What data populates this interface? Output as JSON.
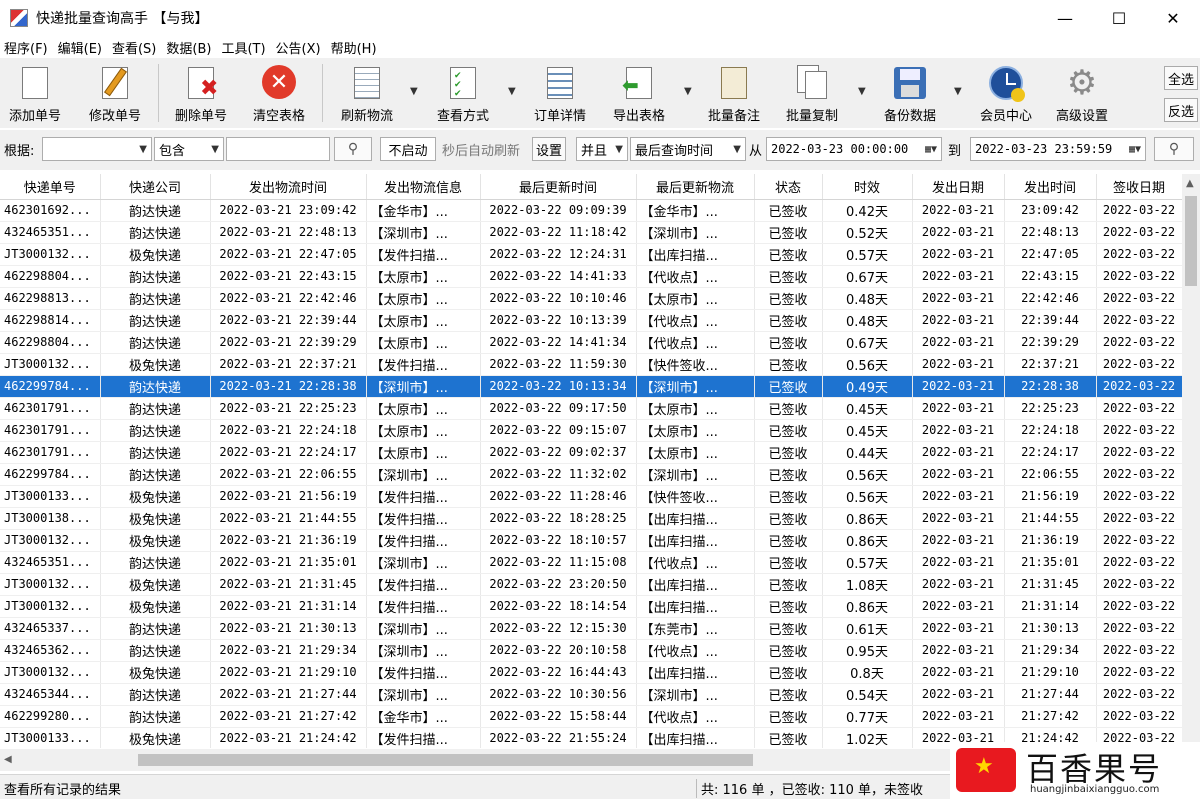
{
  "window": {
    "title": "快递批量查询高手 【与我】",
    "min_symbol": "—",
    "max_symbol": "☐",
    "close_symbol": "✕"
  },
  "menu": [
    "程序(F)",
    "编辑(E)",
    "查看(S)",
    "数据(B)",
    "工具(T)",
    "公告(X)",
    "帮助(H)"
  ],
  "toolbar": {
    "add": "添加单号",
    "edit": "修改单号",
    "delete": "删除单号",
    "clear": "清空表格",
    "refresh": "刷新物流",
    "view": "查看方式",
    "order_detail": "订单详情",
    "export": "导出表格",
    "batch_note": "批量备注",
    "batch_copy": "批量复制",
    "backup": "备份数据",
    "member": "会员中心",
    "advanced": "高级设置",
    "select_all": "全选",
    "invert": "反选"
  },
  "filter": {
    "basis_label": "根据:",
    "basis_value": "",
    "match_value": "包含",
    "keyword_value": "",
    "auto_button": "不启动",
    "auto_hint": "秒后自动刷新",
    "settings_button": "设置",
    "logic_value": "并且",
    "time_field_value": "最后查询时间",
    "from_label": "从",
    "from_value": "2022-03-23 00:00:00",
    "to_label": "到",
    "to_value": "2022-03-23 23:59:59"
  },
  "table": {
    "columns": [
      "快递单号",
      "快递公司",
      "发出物流时间",
      "发出物流信息",
      "最后更新时间",
      "最后更新物流",
      "状态",
      "时效",
      "发出日期",
      "发出时间",
      "签收日期"
    ],
    "rows": [
      [
        "462301692...",
        "韵达快递",
        "2022-03-21 23:09:42",
        "【金华市】...",
        "2022-03-22 09:09:39",
        "【金华市】...",
        "已签收",
        "0.42天",
        "2022-03-21",
        "23:09:42",
        "2022-03-22"
      ],
      [
        "432465351...",
        "韵达快递",
        "2022-03-21 22:48:13",
        "【深圳市】...",
        "2022-03-22 11:18:42",
        "【深圳市】...",
        "已签收",
        "0.52天",
        "2022-03-21",
        "22:48:13",
        "2022-03-22"
      ],
      [
        "JT3000132...",
        "极兔快递",
        "2022-03-21 22:47:05",
        "【发件扫描...",
        "2022-03-22 12:24:31",
        "【出库扫描...",
        "已签收",
        "0.57天",
        "2022-03-21",
        "22:47:05",
        "2022-03-22"
      ],
      [
        "462298804...",
        "韵达快递",
        "2022-03-21 22:43:15",
        "【太原市】...",
        "2022-03-22 14:41:33",
        "【代收点】...",
        "已签收",
        "0.67天",
        "2022-03-21",
        "22:43:15",
        "2022-03-22"
      ],
      [
        "462298813...",
        "韵达快递",
        "2022-03-21 22:42:46",
        "【太原市】...",
        "2022-03-22 10:10:46",
        "【太原市】...",
        "已签收",
        "0.48天",
        "2022-03-21",
        "22:42:46",
        "2022-03-22"
      ],
      [
        "462298814...",
        "韵达快递",
        "2022-03-21 22:39:44",
        "【太原市】...",
        "2022-03-22 10:13:39",
        "【代收点】...",
        "已签收",
        "0.48天",
        "2022-03-21",
        "22:39:44",
        "2022-03-22"
      ],
      [
        "462298804...",
        "韵达快递",
        "2022-03-21 22:39:29",
        "【太原市】...",
        "2022-03-22 14:41:34",
        "【代收点】...",
        "已签收",
        "0.67天",
        "2022-03-21",
        "22:39:29",
        "2022-03-22"
      ],
      [
        "JT3000132...",
        "极兔快递",
        "2022-03-21 22:37:21",
        "【发件扫描...",
        "2022-03-22 11:59:30",
        "【快件签收...",
        "已签收",
        "0.56天",
        "2022-03-21",
        "22:37:21",
        "2022-03-22"
      ],
      [
        "462299784...",
        "韵达快递",
        "2022-03-21 22:28:38",
        "【深圳市】...",
        "2022-03-22 10:13:34",
        "【深圳市】...",
        "已签收",
        "0.49天",
        "2022-03-21",
        "22:28:38",
        "2022-03-22"
      ],
      [
        "462301791...",
        "韵达快递",
        "2022-03-21 22:25:23",
        "【太原市】...",
        "2022-03-22 09:17:50",
        "【太原市】...",
        "已签收",
        "0.45天",
        "2022-03-21",
        "22:25:23",
        "2022-03-22"
      ],
      [
        "462301791...",
        "韵达快递",
        "2022-03-21 22:24:18",
        "【太原市】...",
        "2022-03-22 09:15:07",
        "【太原市】...",
        "已签收",
        "0.45天",
        "2022-03-21",
        "22:24:18",
        "2022-03-22"
      ],
      [
        "462301791...",
        "韵达快递",
        "2022-03-21 22:24:17",
        "【太原市】...",
        "2022-03-22 09:02:37",
        "【太原市】...",
        "已签收",
        "0.44天",
        "2022-03-21",
        "22:24:17",
        "2022-03-22"
      ],
      [
        "462299784...",
        "韵达快递",
        "2022-03-21 22:06:55",
        "【深圳市】...",
        "2022-03-22 11:32:02",
        "【深圳市】...",
        "已签收",
        "0.56天",
        "2022-03-21",
        "22:06:55",
        "2022-03-22"
      ],
      [
        "JT3000133...",
        "极兔快递",
        "2022-03-21 21:56:19",
        "【发件扫描...",
        "2022-03-22 11:28:46",
        "【快件签收...",
        "已签收",
        "0.56天",
        "2022-03-21",
        "21:56:19",
        "2022-03-22"
      ],
      [
        "JT3000138...",
        "极兔快递",
        "2022-03-21 21:44:55",
        "【发件扫描...",
        "2022-03-22 18:28:25",
        "【出库扫描...",
        "已签收",
        "0.86天",
        "2022-03-21",
        "21:44:55",
        "2022-03-22"
      ],
      [
        "JT3000132...",
        "极兔快递",
        "2022-03-21 21:36:19",
        "【发件扫描...",
        "2022-03-22 18:10:57",
        "【出库扫描...",
        "已签收",
        "0.86天",
        "2022-03-21",
        "21:36:19",
        "2022-03-22"
      ],
      [
        "432465351...",
        "韵达快递",
        "2022-03-21 21:35:01",
        "【深圳市】...",
        "2022-03-22 11:15:08",
        "【代收点】...",
        "已签收",
        "0.57天",
        "2022-03-21",
        "21:35:01",
        "2022-03-22"
      ],
      [
        "JT3000132...",
        "极兔快递",
        "2022-03-21 21:31:45",
        "【发件扫描...",
        "2022-03-22 23:20:50",
        "【出库扫描...",
        "已签收",
        "1.08天",
        "2022-03-21",
        "21:31:45",
        "2022-03-22"
      ],
      [
        "JT3000132...",
        "极兔快递",
        "2022-03-21 21:31:14",
        "【发件扫描...",
        "2022-03-22 18:14:54",
        "【出库扫描...",
        "已签收",
        "0.86天",
        "2022-03-21",
        "21:31:14",
        "2022-03-22"
      ],
      [
        "432465337...",
        "韵达快递",
        "2022-03-21 21:30:13",
        "【深圳市】...",
        "2022-03-22 12:15:30",
        "【东莞市】...",
        "已签收",
        "0.61天",
        "2022-03-21",
        "21:30:13",
        "2022-03-22"
      ],
      [
        "432465362...",
        "韵达快递",
        "2022-03-21 21:29:34",
        "【深圳市】...",
        "2022-03-22 20:10:58",
        "【代收点】...",
        "已签收",
        "0.95天",
        "2022-03-21",
        "21:29:34",
        "2022-03-22"
      ],
      [
        "JT3000132...",
        "极兔快递",
        "2022-03-21 21:29:10",
        "【发件扫描...",
        "2022-03-22 16:44:43",
        "【出库扫描...",
        "已签收",
        "0.8天",
        "2022-03-21",
        "21:29:10",
        "2022-03-22"
      ],
      [
        "432465344...",
        "韵达快递",
        "2022-03-21 21:27:44",
        "【深圳市】...",
        "2022-03-22 10:30:56",
        "【深圳市】...",
        "已签收",
        "0.54天",
        "2022-03-21",
        "21:27:44",
        "2022-03-22"
      ],
      [
        "462299280...",
        "韵达快递",
        "2022-03-21 21:27:42",
        "【金华市】...",
        "2022-03-22 15:58:44",
        "【代收点】...",
        "已签收",
        "0.77天",
        "2022-03-21",
        "21:27:42",
        "2022-03-22"
      ],
      [
        "JT3000133...",
        "极兔快递",
        "2022-03-21 21:24:42",
        "【发件扫描...",
        "2022-03-22 21:55:24",
        "【出库扫描...",
        "已签收",
        "1.02天",
        "2022-03-21",
        "21:24:42",
        "2022-03-22"
      ]
    ],
    "selected_row": 8
  },
  "status": {
    "left": "查看所有记录的结果",
    "right": "共: 116 单 ，已签收:  110 单，未签收"
  },
  "watermark": {
    "cn": "百香果号",
    "url": "huangjinbaixiangguo.com"
  }
}
